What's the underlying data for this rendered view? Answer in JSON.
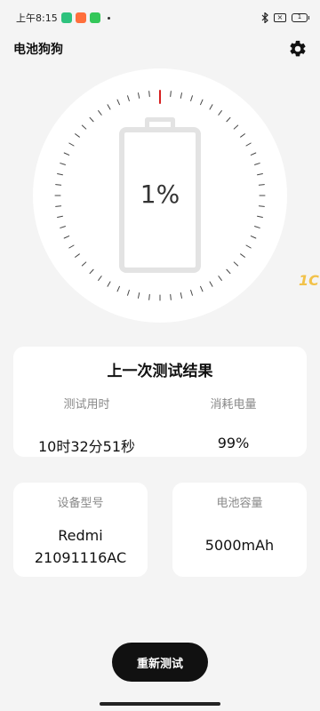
{
  "status_bar": {
    "time": "上午8:15",
    "battery_level": "1",
    "icons": [
      "bluetooth-icon",
      "no-sim-icon",
      "battery-icon"
    ],
    "app_notification_colors": [
      "#2ec27e",
      "#ff6f3c",
      "#34c759"
    ]
  },
  "header": {
    "title": "电池狗狗",
    "settings_icon": "gear-icon"
  },
  "gauge": {
    "percent_text": "1%",
    "level": 0.01,
    "accent_color": "#d62020",
    "tick_color": "#444444"
  },
  "result_card": {
    "title": "上一次测试结果",
    "duration_label": "测试用时",
    "duration_value": "10时32分51秒",
    "consumed_label": "消耗电量",
    "consumed_value": "99%"
  },
  "device_card": {
    "label": "设备型号",
    "value_line1": "Redmi",
    "value_line2": "21091116AC"
  },
  "capacity_card": {
    "label": "电池容量",
    "value": "5000mAh"
  },
  "watermark": "1C",
  "retest_button": "重新测试"
}
